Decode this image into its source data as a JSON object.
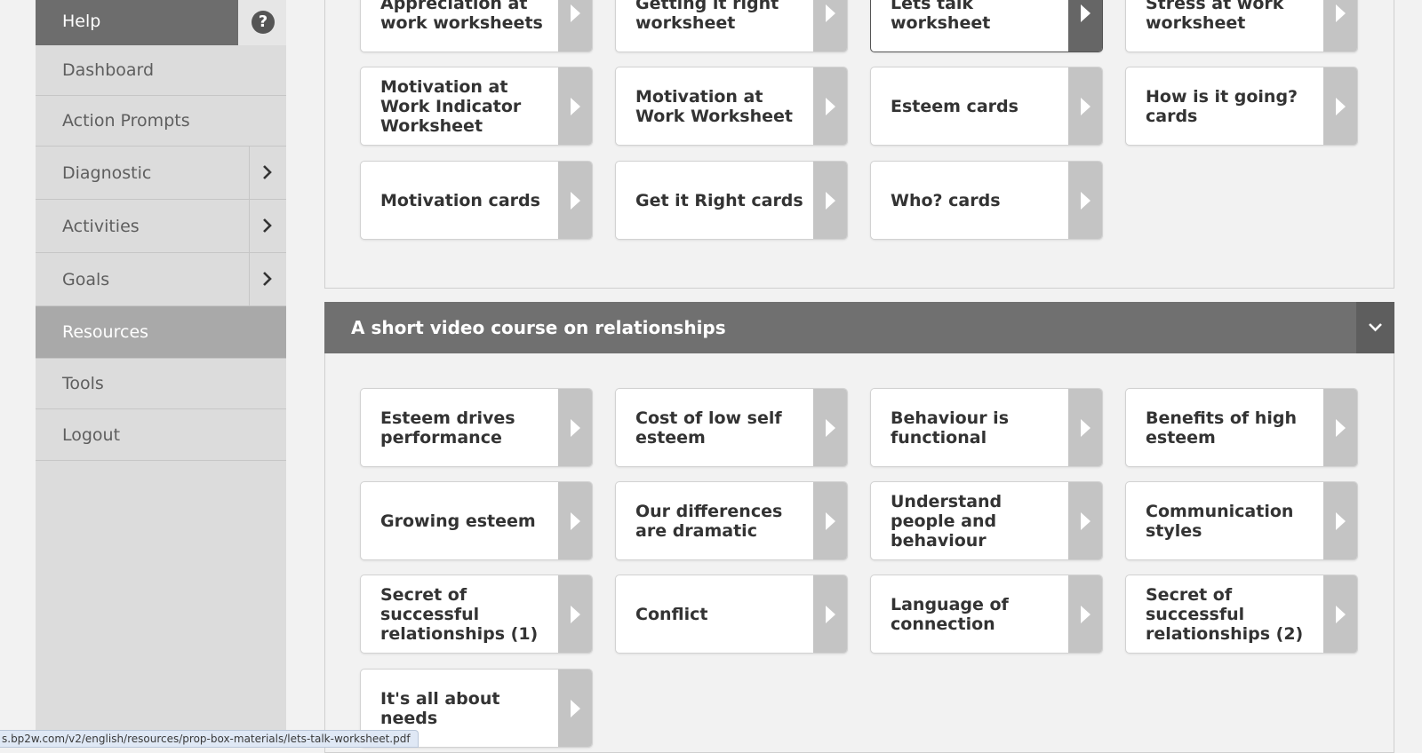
{
  "sidebar": {
    "help_label": "Help",
    "items": [
      {
        "label": "Dashboard",
        "has_chevron": false,
        "active": false
      },
      {
        "label": "Action Prompts",
        "has_chevron": false,
        "active": false
      },
      {
        "label": "Diagnostic",
        "has_chevron": true,
        "active": false
      },
      {
        "label": "Activities",
        "has_chevron": true,
        "active": false
      },
      {
        "label": "Goals",
        "has_chevron": true,
        "active": false
      },
      {
        "label": "Resources",
        "has_chevron": false,
        "active": true
      },
      {
        "label": "Tools",
        "has_chevron": false,
        "active": false
      },
      {
        "label": "Logout",
        "has_chevron": false,
        "active": false
      }
    ]
  },
  "top_panel": {
    "cards": [
      "Appreciation at work worksheets",
      "Getting it right worksheet",
      "Lets talk worksheet",
      "Stress at work worksheet",
      "Motivation at Work Indicator Worksheet",
      "Motivation at Work Worksheet",
      "Esteem cards",
      "How is it going? cards",
      "Motivation cards",
      "Get it Right cards",
      "Who? cards"
    ]
  },
  "video_section": {
    "title": "A short video course on relationships",
    "cards": [
      "Esteem drives performance",
      "Cost of low self esteem",
      "Behaviour is functional",
      "Benefits of high esteem",
      "Growing esteem",
      "Our differences are dramatic",
      "Understand people and behaviour",
      "Communication styles",
      "Secret of successful relationships (1)",
      "Conflict",
      "Language of connection",
      "Secret of successful relationships (2)",
      "It's all about needs"
    ]
  },
  "status_bar": {
    "url": "s.bp2w.com/v2/english/resources/prop-box-materials/lets-talk-worksheet.pdf"
  },
  "colors": {
    "sidebar_bg": "#dcdcdc",
    "help_bg": "#6d6d6d",
    "active_nav_bg": "#a9a9a9",
    "section_header_bg": "#707070",
    "card_arrow_bg": "#c4c4c4",
    "selected_arrow_bg": "#666666"
  }
}
